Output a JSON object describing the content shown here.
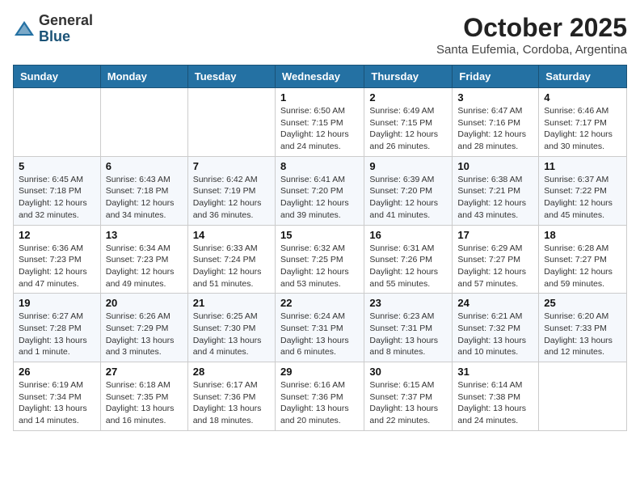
{
  "logo": {
    "general": "General",
    "blue": "Blue"
  },
  "header": {
    "month": "October 2025",
    "location": "Santa Eufemia, Cordoba, Argentina"
  },
  "weekdays": [
    "Sunday",
    "Monday",
    "Tuesday",
    "Wednesday",
    "Thursday",
    "Friday",
    "Saturday"
  ],
  "weeks": [
    [
      {
        "day": "",
        "info": ""
      },
      {
        "day": "",
        "info": ""
      },
      {
        "day": "",
        "info": ""
      },
      {
        "day": "1",
        "info": "Sunrise: 6:50 AM\nSunset: 7:15 PM\nDaylight: 12 hours\nand 24 minutes."
      },
      {
        "day": "2",
        "info": "Sunrise: 6:49 AM\nSunset: 7:15 PM\nDaylight: 12 hours\nand 26 minutes."
      },
      {
        "day": "3",
        "info": "Sunrise: 6:47 AM\nSunset: 7:16 PM\nDaylight: 12 hours\nand 28 minutes."
      },
      {
        "day": "4",
        "info": "Sunrise: 6:46 AM\nSunset: 7:17 PM\nDaylight: 12 hours\nand 30 minutes."
      }
    ],
    [
      {
        "day": "5",
        "info": "Sunrise: 6:45 AM\nSunset: 7:18 PM\nDaylight: 12 hours\nand 32 minutes."
      },
      {
        "day": "6",
        "info": "Sunrise: 6:43 AM\nSunset: 7:18 PM\nDaylight: 12 hours\nand 34 minutes."
      },
      {
        "day": "7",
        "info": "Sunrise: 6:42 AM\nSunset: 7:19 PM\nDaylight: 12 hours\nand 36 minutes."
      },
      {
        "day": "8",
        "info": "Sunrise: 6:41 AM\nSunset: 7:20 PM\nDaylight: 12 hours\nand 39 minutes."
      },
      {
        "day": "9",
        "info": "Sunrise: 6:39 AM\nSunset: 7:20 PM\nDaylight: 12 hours\nand 41 minutes."
      },
      {
        "day": "10",
        "info": "Sunrise: 6:38 AM\nSunset: 7:21 PM\nDaylight: 12 hours\nand 43 minutes."
      },
      {
        "day": "11",
        "info": "Sunrise: 6:37 AM\nSunset: 7:22 PM\nDaylight: 12 hours\nand 45 minutes."
      }
    ],
    [
      {
        "day": "12",
        "info": "Sunrise: 6:36 AM\nSunset: 7:23 PM\nDaylight: 12 hours\nand 47 minutes."
      },
      {
        "day": "13",
        "info": "Sunrise: 6:34 AM\nSunset: 7:23 PM\nDaylight: 12 hours\nand 49 minutes."
      },
      {
        "day": "14",
        "info": "Sunrise: 6:33 AM\nSunset: 7:24 PM\nDaylight: 12 hours\nand 51 minutes."
      },
      {
        "day": "15",
        "info": "Sunrise: 6:32 AM\nSunset: 7:25 PM\nDaylight: 12 hours\nand 53 minutes."
      },
      {
        "day": "16",
        "info": "Sunrise: 6:31 AM\nSunset: 7:26 PM\nDaylight: 12 hours\nand 55 minutes."
      },
      {
        "day": "17",
        "info": "Sunrise: 6:29 AM\nSunset: 7:27 PM\nDaylight: 12 hours\nand 57 minutes."
      },
      {
        "day": "18",
        "info": "Sunrise: 6:28 AM\nSunset: 7:27 PM\nDaylight: 12 hours\nand 59 minutes."
      }
    ],
    [
      {
        "day": "19",
        "info": "Sunrise: 6:27 AM\nSunset: 7:28 PM\nDaylight: 13 hours\nand 1 minute."
      },
      {
        "day": "20",
        "info": "Sunrise: 6:26 AM\nSunset: 7:29 PM\nDaylight: 13 hours\nand 3 minutes."
      },
      {
        "day": "21",
        "info": "Sunrise: 6:25 AM\nSunset: 7:30 PM\nDaylight: 13 hours\nand 4 minutes."
      },
      {
        "day": "22",
        "info": "Sunrise: 6:24 AM\nSunset: 7:31 PM\nDaylight: 13 hours\nand 6 minutes."
      },
      {
        "day": "23",
        "info": "Sunrise: 6:23 AM\nSunset: 7:31 PM\nDaylight: 13 hours\nand 8 minutes."
      },
      {
        "day": "24",
        "info": "Sunrise: 6:21 AM\nSunset: 7:32 PM\nDaylight: 13 hours\nand 10 minutes."
      },
      {
        "day": "25",
        "info": "Sunrise: 6:20 AM\nSunset: 7:33 PM\nDaylight: 13 hours\nand 12 minutes."
      }
    ],
    [
      {
        "day": "26",
        "info": "Sunrise: 6:19 AM\nSunset: 7:34 PM\nDaylight: 13 hours\nand 14 minutes."
      },
      {
        "day": "27",
        "info": "Sunrise: 6:18 AM\nSunset: 7:35 PM\nDaylight: 13 hours\nand 16 minutes."
      },
      {
        "day": "28",
        "info": "Sunrise: 6:17 AM\nSunset: 7:36 PM\nDaylight: 13 hours\nand 18 minutes."
      },
      {
        "day": "29",
        "info": "Sunrise: 6:16 AM\nSunset: 7:36 PM\nDaylight: 13 hours\nand 20 minutes."
      },
      {
        "day": "30",
        "info": "Sunrise: 6:15 AM\nSunset: 7:37 PM\nDaylight: 13 hours\nand 22 minutes."
      },
      {
        "day": "31",
        "info": "Sunrise: 6:14 AM\nSunset: 7:38 PM\nDaylight: 13 hours\nand 24 minutes."
      },
      {
        "day": "",
        "info": ""
      }
    ]
  ]
}
